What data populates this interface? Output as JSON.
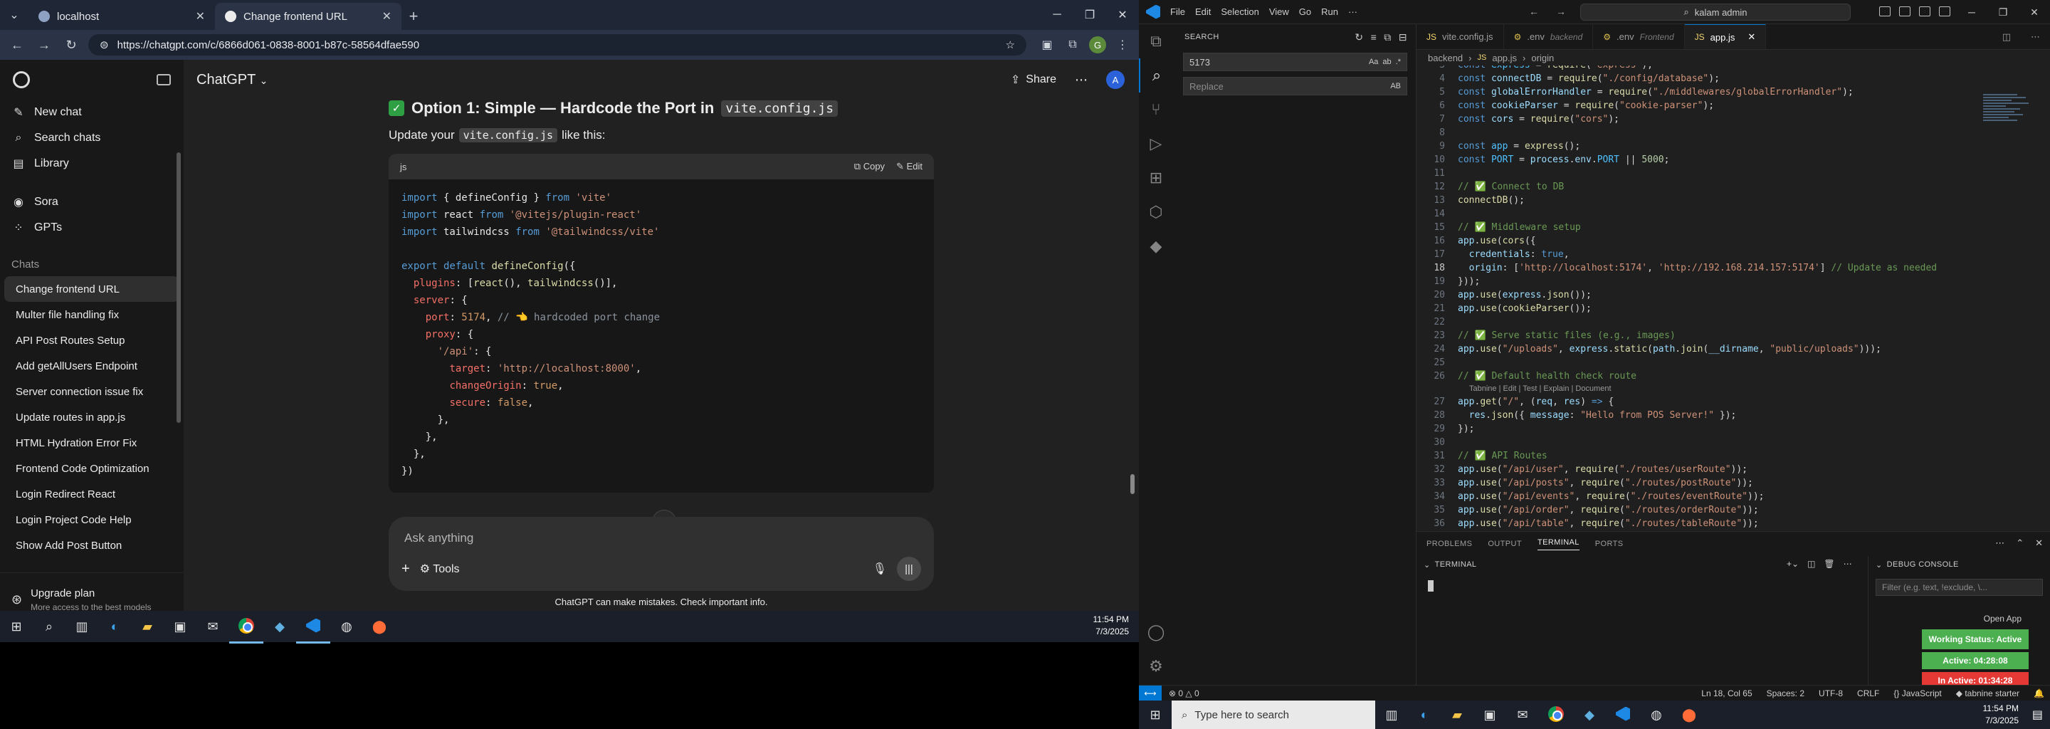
{
  "browser": {
    "tabs": [
      {
        "title": "localhost",
        "active": false
      },
      {
        "title": "Change frontend URL",
        "active": true
      }
    ],
    "url": "https://chatgpt.com/c/6866d061-0838-8001-b87c-58564dfae590",
    "profile_initial": "G"
  },
  "sidebar": {
    "nav": [
      {
        "label": "New chat",
        "icon": "new-chat-icon"
      },
      {
        "label": "Search chats",
        "icon": "search-icon"
      },
      {
        "label": "Library",
        "icon": "library-icon"
      },
      {
        "label": "Sora",
        "icon": "sora-icon"
      },
      {
        "label": "GPTs",
        "icon": "gpts-icon"
      }
    ],
    "section_label": "Chats",
    "chats": [
      "Change frontend URL",
      "Multer file handling fix",
      "API Post Routes Setup",
      "Add getAllUsers Endpoint",
      "Server connection issue fix",
      "Update routes in app.js",
      "HTML Hydration Error Fix",
      "Frontend Code Optimization",
      "Login Redirect React",
      "Login Project Code Help",
      "Show Add Post Button"
    ],
    "upgrade_title": "Upgrade plan",
    "upgrade_sub": "More access to the best models"
  },
  "chat": {
    "model": "ChatGPT",
    "share_label": "Share",
    "user_initial": "A",
    "option_heading_pre": "Option 1: Simple — Hardcode the Port in",
    "option_heading_code": "vite.config.js",
    "update_pre": "Update your",
    "update_code": "vite.config.js",
    "update_post": "like this:",
    "code_lang": "js",
    "copy_label": "Copy",
    "edit_label": "Edit",
    "composer_placeholder": "Ask anything",
    "tools_label": "Tools",
    "disclaimer": "ChatGPT can make mistakes. Check important info."
  },
  "taskbar_left": {
    "time": "11:54 PM",
    "date": "7/3/2025"
  },
  "vscode": {
    "menu": [
      "File",
      "Edit",
      "Selection",
      "View",
      "Go",
      "Run"
    ],
    "more_menu": "···",
    "command_center": "kalam admin",
    "search": {
      "title": "SEARCH",
      "query": "5173",
      "replace_placeholder": "Replace",
      "match_case": "Aa",
      "whole_word": "ab",
      "regex": ".*",
      "preserve_case": "AB"
    },
    "tabs": [
      {
        "name": "vite.config.js",
        "desc": "",
        "active": false
      },
      {
        "name": ".env",
        "desc": "backend",
        "active": false
      },
      {
        "name": ".env",
        "desc": "Frontend",
        "active": false
      },
      {
        "name": "app.js",
        "desc": "",
        "active": true
      }
    ],
    "breadcrumbs": [
      "backend",
      "app.js",
      "origin"
    ],
    "codelens": "Tabnine | Edit | Test | Explain | Document",
    "panel_tabs": [
      "PROBLEMS",
      "OUTPUT",
      "TERMINAL",
      "PORTS"
    ],
    "terminal_label": "TERMINAL",
    "debug_label": "DEBUG CONSOLE",
    "debug_filter": "Filter (e.g. text, !exclude, \\...",
    "status": {
      "problems": "0",
      "warnings": "0",
      "position": "Ln 18, Col 65",
      "spaces": "Spaces: 2",
      "encoding": "UTF-8",
      "eol": "CRLF",
      "language": "JavaScript",
      "tabnine": "tabnine starter"
    }
  },
  "tracker": {
    "open_app": "Open App",
    "working_status": "Working Status: Active",
    "active": "Active: 04:28:08",
    "inactive": "In Active: 01:34:28"
  },
  "taskbar_right": {
    "search_placeholder": "Type here to search",
    "time": "11:54 PM",
    "date": "7/3/2025"
  }
}
